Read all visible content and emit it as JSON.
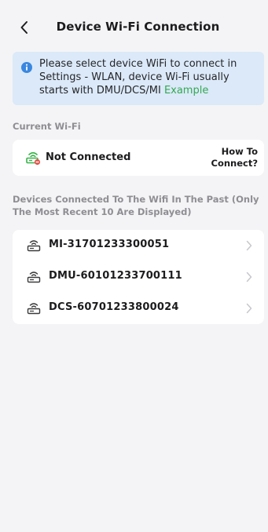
{
  "header": {
    "title": "Device Wi-Fi Connection"
  },
  "info": {
    "message": "Please select device WiFi to connect in Settings - WLAN, device Wi-Fi usually starts with DMU/DCS/MI",
    "link_label": "Example",
    "link_color": "#33a852"
  },
  "current": {
    "section_label": "Current Wi-Fi",
    "status": "Not Connected",
    "help_line1": "How To",
    "help_line2": "Connect?"
  },
  "past": {
    "section_label": "Devices Connected To The Wifi In The Past (Only The Most Recent 10 Are Displayed)",
    "devices": [
      {
        "name": "MI-31701233300051"
      },
      {
        "name": "DMU-60101233700111"
      },
      {
        "name": "DCS-60701233800024"
      }
    ]
  },
  "icons": {
    "back": "chevron-left-icon",
    "info": "info-icon",
    "router_disconnected": "router-disconnected-icon",
    "router": "router-icon",
    "chevron": "chevron-right-icon"
  },
  "colors": {
    "background": "#f4f4f6",
    "info_background": "#dbe9f8",
    "info_icon": "#3a87e0",
    "section_label": "#8e8e93",
    "disconnect_red": "#e5534b",
    "router_green": "#38b44a"
  }
}
